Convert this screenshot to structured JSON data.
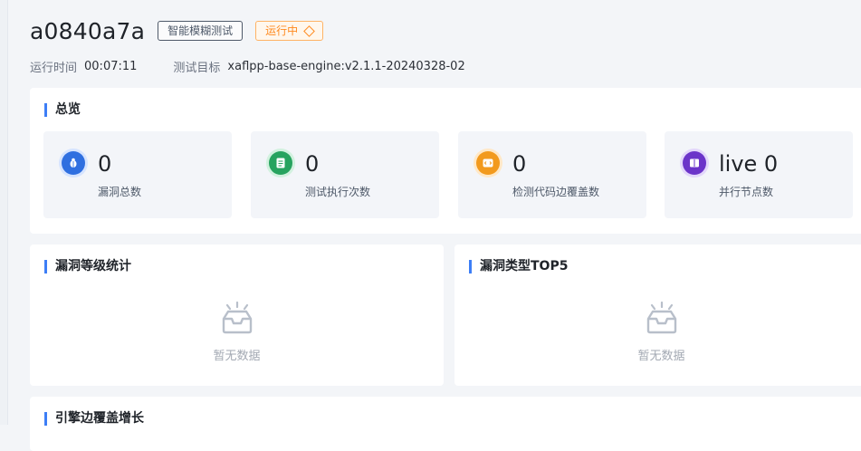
{
  "header": {
    "task_id": "a0840a7a",
    "type_tag": "智能模糊测试",
    "status_tag": "运行中",
    "runtime_label": "运行时间",
    "runtime_value": "00:07:11",
    "target_label": "测试目标",
    "target_value": "xaflpp-base-engine:v2.1.1-20240328-02"
  },
  "overview": {
    "title": "总览",
    "stats": [
      {
        "value": "0",
        "label": "漏洞总数",
        "icon": "bug-icon",
        "color": "#2f6fe0"
      },
      {
        "value": "0",
        "label": "测试执行次数",
        "icon": "document-icon",
        "color": "#27a35f"
      },
      {
        "value": "0",
        "label": "检测代码边覆盖数",
        "icon": "code-icon",
        "color": "#f29a1e"
      },
      {
        "value": "live 0",
        "label": "并行节点数",
        "icon": "book-icon",
        "color": "#6b34c9"
      }
    ]
  },
  "severity_panel": {
    "title": "漏洞等级统计",
    "empty_text": "暂无数据"
  },
  "type_panel": {
    "title": "漏洞类型TOP5",
    "empty_text": "暂无数据"
  },
  "coverage_panel": {
    "title": "引擎边覆盖增长"
  }
}
